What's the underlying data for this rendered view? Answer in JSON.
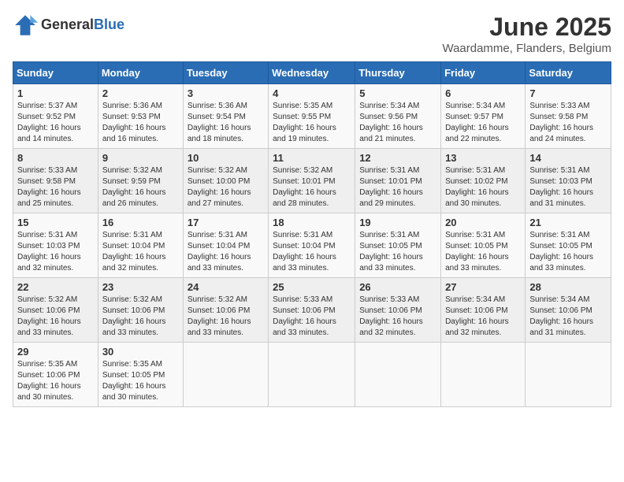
{
  "logo": {
    "general": "General",
    "blue": "Blue"
  },
  "title": "June 2025",
  "subtitle": "Waardamme, Flanders, Belgium",
  "days_header": [
    "Sunday",
    "Monday",
    "Tuesday",
    "Wednesday",
    "Thursday",
    "Friday",
    "Saturday"
  ],
  "weeks": [
    [
      {
        "day": "1",
        "info": "Sunrise: 5:37 AM\nSunset: 9:52 PM\nDaylight: 16 hours\nand 14 minutes."
      },
      {
        "day": "2",
        "info": "Sunrise: 5:36 AM\nSunset: 9:53 PM\nDaylight: 16 hours\nand 16 minutes."
      },
      {
        "day": "3",
        "info": "Sunrise: 5:36 AM\nSunset: 9:54 PM\nDaylight: 16 hours\nand 18 minutes."
      },
      {
        "day": "4",
        "info": "Sunrise: 5:35 AM\nSunset: 9:55 PM\nDaylight: 16 hours\nand 19 minutes."
      },
      {
        "day": "5",
        "info": "Sunrise: 5:34 AM\nSunset: 9:56 PM\nDaylight: 16 hours\nand 21 minutes."
      },
      {
        "day": "6",
        "info": "Sunrise: 5:34 AM\nSunset: 9:57 PM\nDaylight: 16 hours\nand 22 minutes."
      },
      {
        "day": "7",
        "info": "Sunrise: 5:33 AM\nSunset: 9:58 PM\nDaylight: 16 hours\nand 24 minutes."
      }
    ],
    [
      {
        "day": "8",
        "info": "Sunrise: 5:33 AM\nSunset: 9:58 PM\nDaylight: 16 hours\nand 25 minutes."
      },
      {
        "day": "9",
        "info": "Sunrise: 5:32 AM\nSunset: 9:59 PM\nDaylight: 16 hours\nand 26 minutes."
      },
      {
        "day": "10",
        "info": "Sunrise: 5:32 AM\nSunset: 10:00 PM\nDaylight: 16 hours\nand 27 minutes."
      },
      {
        "day": "11",
        "info": "Sunrise: 5:32 AM\nSunset: 10:01 PM\nDaylight: 16 hours\nand 28 minutes."
      },
      {
        "day": "12",
        "info": "Sunrise: 5:31 AM\nSunset: 10:01 PM\nDaylight: 16 hours\nand 29 minutes."
      },
      {
        "day": "13",
        "info": "Sunrise: 5:31 AM\nSunset: 10:02 PM\nDaylight: 16 hours\nand 30 minutes."
      },
      {
        "day": "14",
        "info": "Sunrise: 5:31 AM\nSunset: 10:03 PM\nDaylight: 16 hours\nand 31 minutes."
      }
    ],
    [
      {
        "day": "15",
        "info": "Sunrise: 5:31 AM\nSunset: 10:03 PM\nDaylight: 16 hours\nand 32 minutes."
      },
      {
        "day": "16",
        "info": "Sunrise: 5:31 AM\nSunset: 10:04 PM\nDaylight: 16 hours\nand 32 minutes."
      },
      {
        "day": "17",
        "info": "Sunrise: 5:31 AM\nSunset: 10:04 PM\nDaylight: 16 hours\nand 33 minutes."
      },
      {
        "day": "18",
        "info": "Sunrise: 5:31 AM\nSunset: 10:04 PM\nDaylight: 16 hours\nand 33 minutes."
      },
      {
        "day": "19",
        "info": "Sunrise: 5:31 AM\nSunset: 10:05 PM\nDaylight: 16 hours\nand 33 minutes."
      },
      {
        "day": "20",
        "info": "Sunrise: 5:31 AM\nSunset: 10:05 PM\nDaylight: 16 hours\nand 33 minutes."
      },
      {
        "day": "21",
        "info": "Sunrise: 5:31 AM\nSunset: 10:05 PM\nDaylight: 16 hours\nand 33 minutes."
      }
    ],
    [
      {
        "day": "22",
        "info": "Sunrise: 5:32 AM\nSunset: 10:06 PM\nDaylight: 16 hours\nand 33 minutes."
      },
      {
        "day": "23",
        "info": "Sunrise: 5:32 AM\nSunset: 10:06 PM\nDaylight: 16 hours\nand 33 minutes."
      },
      {
        "day": "24",
        "info": "Sunrise: 5:32 AM\nSunset: 10:06 PM\nDaylight: 16 hours\nand 33 minutes."
      },
      {
        "day": "25",
        "info": "Sunrise: 5:33 AM\nSunset: 10:06 PM\nDaylight: 16 hours\nand 33 minutes."
      },
      {
        "day": "26",
        "info": "Sunrise: 5:33 AM\nSunset: 10:06 PM\nDaylight: 16 hours\nand 32 minutes."
      },
      {
        "day": "27",
        "info": "Sunrise: 5:34 AM\nSunset: 10:06 PM\nDaylight: 16 hours\nand 32 minutes."
      },
      {
        "day": "28",
        "info": "Sunrise: 5:34 AM\nSunset: 10:06 PM\nDaylight: 16 hours\nand 31 minutes."
      }
    ],
    [
      {
        "day": "29",
        "info": "Sunrise: 5:35 AM\nSunset: 10:06 PM\nDaylight: 16 hours\nand 30 minutes."
      },
      {
        "day": "30",
        "info": "Sunrise: 5:35 AM\nSunset: 10:05 PM\nDaylight: 16 hours\nand 30 minutes."
      },
      {
        "day": "",
        "info": ""
      },
      {
        "day": "",
        "info": ""
      },
      {
        "day": "",
        "info": ""
      },
      {
        "day": "",
        "info": ""
      },
      {
        "day": "",
        "info": ""
      }
    ]
  ]
}
